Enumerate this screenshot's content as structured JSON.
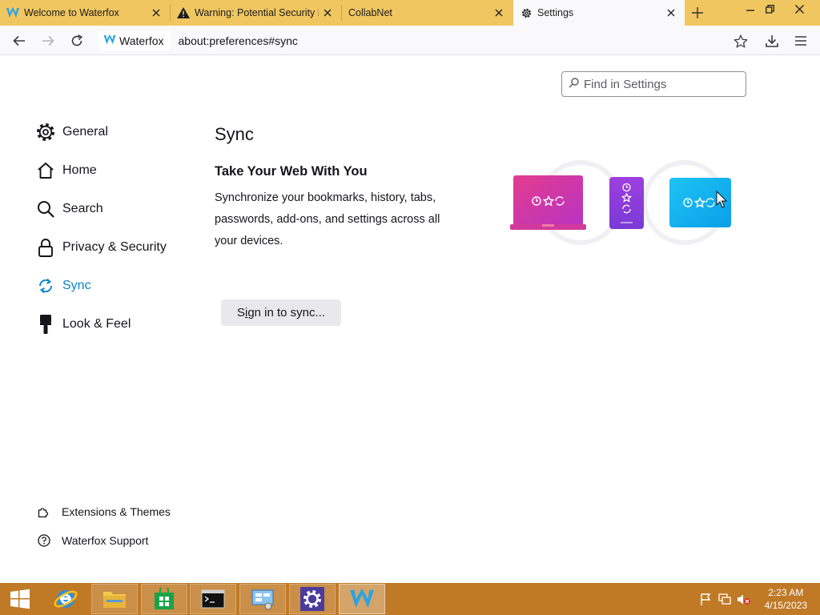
{
  "tabs": [
    {
      "label": "Welcome to Waterfox",
      "icon": "waterfox-icon"
    },
    {
      "label": "Warning: Potential Security Risk Ahead",
      "icon": "warning-icon"
    },
    {
      "label": "CollabNet",
      "icon": ""
    },
    {
      "label": "Settings",
      "icon": "gear-icon",
      "active": true
    }
  ],
  "navbar": {
    "identity_label": "Waterfox",
    "url": "about:preferences#sync"
  },
  "search": {
    "placeholder": "Find in Settings"
  },
  "sidebar": {
    "categories": [
      {
        "label": "General",
        "icon": "gear-icon"
      },
      {
        "label": "Home",
        "icon": "home-icon"
      },
      {
        "label": "Search",
        "icon": "search-icon"
      },
      {
        "label": "Privacy & Security",
        "icon": "lock-icon"
      },
      {
        "label": "Sync",
        "icon": "sync-icon",
        "selected": true
      },
      {
        "label": "Look & Feel",
        "icon": "paintbrush-icon"
      }
    ],
    "footer": [
      {
        "label": "Extensions & Themes",
        "icon": "puzzle-icon"
      },
      {
        "label": "Waterfox Support",
        "icon": "help-icon"
      }
    ]
  },
  "sync": {
    "heading": "Sync",
    "subheading": "Take Your Web With You",
    "description": "Synchronize your bookmarks, history, tabs, passwords, add-ons, and settings across all your devices.",
    "signin_label": "Sign in to sync...",
    "signin_accesskey": "i"
  },
  "taskbar": {
    "time": "2:23 AM",
    "date": "4/15/2023",
    "items": [
      "start-button",
      "internet-explorer",
      "file-explorer",
      "store",
      "command-prompt",
      "network-tool",
      "settings-tool",
      "waterfox"
    ]
  },
  "colors": {
    "tabstrip": "#f0c660",
    "accent": "#0a84c9",
    "taskbar": "#c07a26"
  }
}
